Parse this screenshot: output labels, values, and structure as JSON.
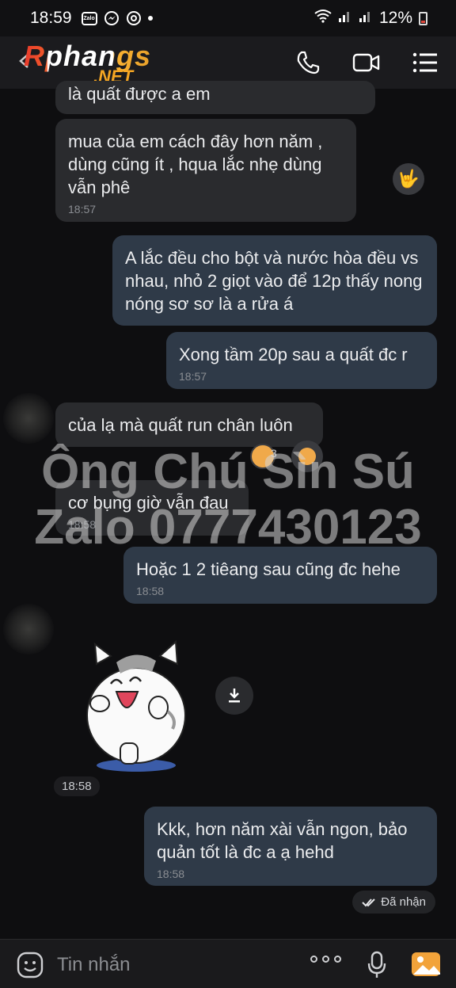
{
  "status_bar": {
    "time": "18:59",
    "zalo_badge": "Zalo",
    "battery": "12%"
  },
  "header": {
    "logo_main": "Rphangs",
    "logo_suffix": ".NET"
  },
  "messages": [
    {
      "direction": "in",
      "text": "là quất được a em",
      "time": ""
    },
    {
      "direction": "in",
      "text": "mua của em cách đây hơn năm , dùng cũng ít , hqua lắc nhẹ dùng vẫn phê",
      "time": "18:57",
      "reaction": "🤟"
    },
    {
      "direction": "out",
      "text": "A lắc đều cho bột và nước hòa đều vs nhau, nhỏ 2 giọt vào để 12p thấy nong nóng sơ sơ là a rửa á",
      "time": ""
    },
    {
      "direction": "out",
      "text": "Xong tầm 20p sau a quất đc r",
      "time": "18:57"
    },
    {
      "direction": "in",
      "text": "của lạ mà quất run chân luôn",
      "time": "",
      "reaction_count": "3"
    },
    {
      "direction": "in",
      "text": "cơ bụng giờ vẫn đau",
      "time": "18:58"
    },
    {
      "direction": "out",
      "text": "Hoặc 1 2  tiêang sau cũng đc hehe",
      "time": "18:58"
    },
    {
      "direction": "out",
      "text": "Kkk, hơn năm xài vẫn ngon, bảo quản tốt là đc a ạ hehd",
      "time": "18:58"
    }
  ],
  "sticker": {
    "time": "18:58"
  },
  "watermark": {
    "line1": "Ông Chú Sìn Sú",
    "line2": "Zalo 0777430123"
  },
  "status_received": "Đã nhận",
  "composer": {
    "placeholder": "Tin nhắn"
  }
}
